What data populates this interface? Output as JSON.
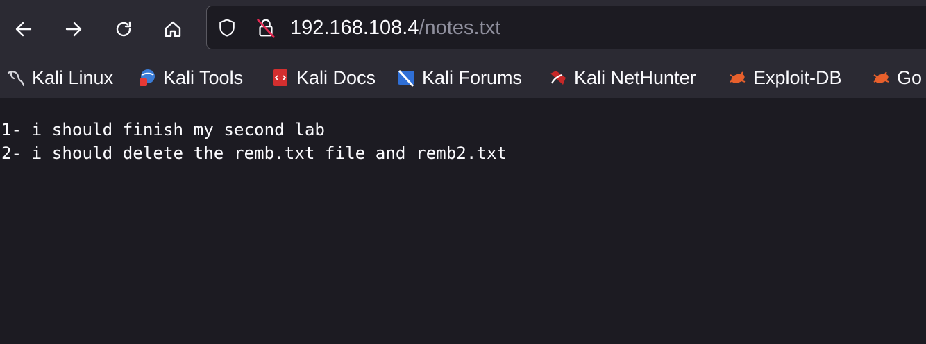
{
  "toolbar": {
    "back_icon": "arrow-left-icon",
    "forward_icon": "arrow-right-icon",
    "reload_icon": "reload-icon",
    "home_icon": "home-icon"
  },
  "urlbar": {
    "tracking_icon": "shield-icon",
    "insecure_icon": "insecure-lock-icon",
    "host": "192.168.108.4",
    "path": "/notes.txt"
  },
  "bookmarks": [
    {
      "label": "Kali Linux",
      "icon": "kali-dragon-icon"
    },
    {
      "label": "Kali Tools",
      "icon": "kali-tools-icon"
    },
    {
      "label": "Kali Docs",
      "icon": "kali-docs-icon"
    },
    {
      "label": "Kali Forums",
      "icon": "kali-forums-icon"
    },
    {
      "label": "Kali NetHunter",
      "icon": "kali-nethunter-icon"
    },
    {
      "label": "Exploit-DB",
      "icon": "exploit-db-icon"
    },
    {
      "label": "Go",
      "icon": "exploit-db-icon"
    }
  ],
  "document": {
    "lines": [
      "1- i should finish my second lab",
      "2- i should delete the remb.txt file and remb2.txt"
    ]
  },
  "colors": {
    "chrome_bg": "#2b2a33",
    "page_bg": "#1c1b22",
    "text": "#fbfbfe",
    "url_path": "#8f8f9d"
  }
}
